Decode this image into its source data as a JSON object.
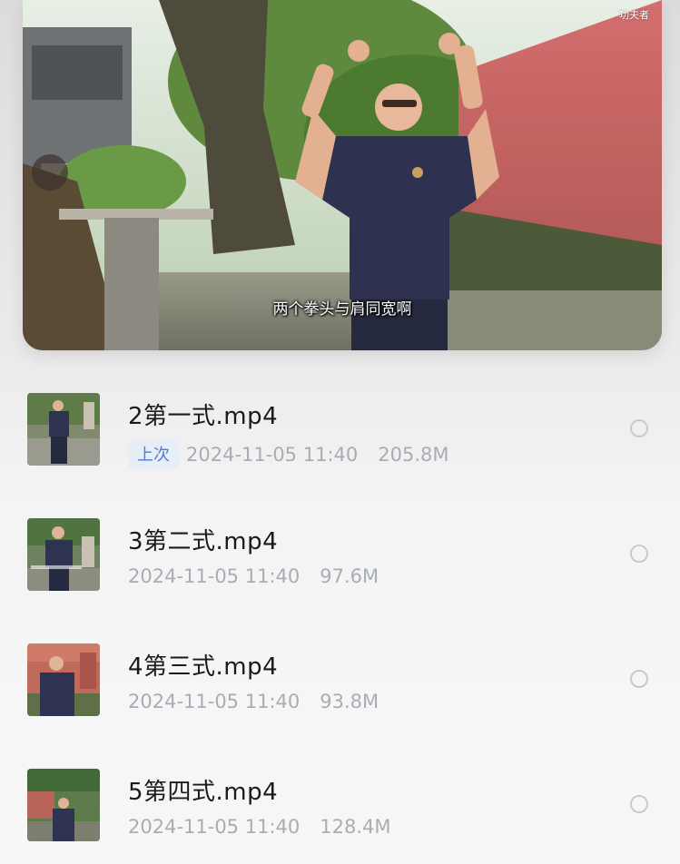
{
  "player": {
    "subtitle": "两个拳头与肩同宽啊",
    "watermark": "功夫者"
  },
  "files": [
    {
      "name": "2第一式.mp4",
      "badge": "上次",
      "date": "2024-11-05 11:40",
      "size": "205.8M",
      "selected": false
    },
    {
      "name": "3第二式.mp4",
      "badge": "",
      "date": "2024-11-05 11:40",
      "size": "97.6M",
      "selected": false
    },
    {
      "name": "4第三式.mp4",
      "badge": "",
      "date": "2024-11-05 11:40",
      "size": "93.8M",
      "selected": false
    },
    {
      "name": "5第四式.mp4",
      "badge": "",
      "date": "2024-11-05 11:40",
      "size": "128.4M",
      "selected": false
    }
  ],
  "colors": {
    "badge_text": "#4b7fd6",
    "badge_bg": "#e8eef8",
    "meta_text": "#a8adb5",
    "title_text": "#1a1a1a"
  }
}
